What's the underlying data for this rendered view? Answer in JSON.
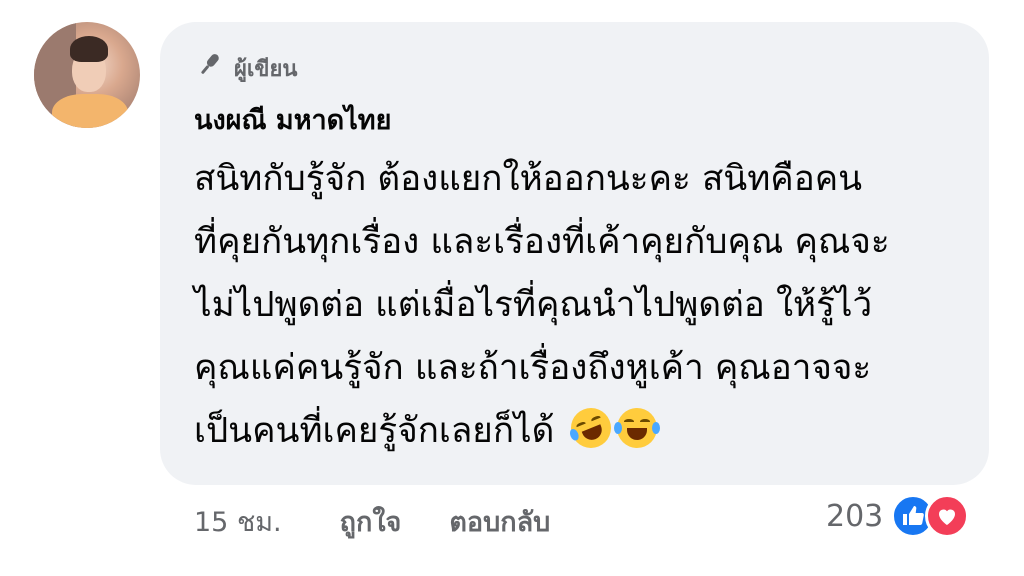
{
  "comment": {
    "author_badge": "ผู้เขียน",
    "author_name": "นงผณี มหาดไทย",
    "text_lines": [
      "สนิทกับรู้จัก ต้องแยกให้ออกนะคะ สนิทคือคน",
      "ที่คุยกันทุกเรื่อง และเรื่องที่เค้าคุยกับคุณ คุณจะ",
      "ไม่ไปพูดต่อ แต่เมื่อไรที่คุณนำไปพูดต่อ ให้รู้ไว้",
      "คุณแค่คนรู้จัก และถ้าเรื่องถึงหูเค้า คุณอาจจะ",
      "เป็นคนที่เคยรู้จักเลยก็ได้"
    ],
    "emojis": [
      "rofl-emoji",
      "joy-emoji"
    ]
  },
  "actions": {
    "timestamp": "15 ชม.",
    "like_label": "ถูกใจ",
    "reply_label": "ตอบกลับ"
  },
  "reactions": {
    "count": "203",
    "icons": [
      "like-icon",
      "love-icon"
    ]
  },
  "colors": {
    "bubble": "#f0f2f5",
    "secondary_text": "#65676b",
    "like_blue": "#1877f2",
    "love_red": "#f33e58"
  }
}
